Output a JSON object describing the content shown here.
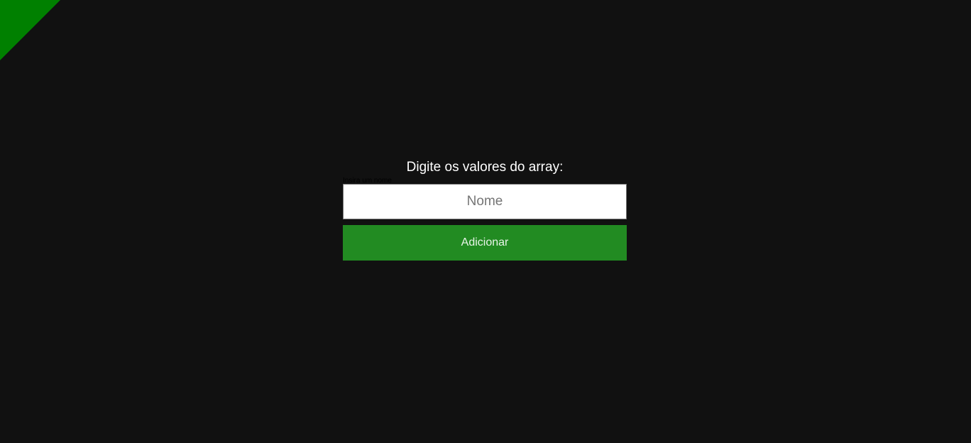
{
  "form": {
    "title": "Digite os valores do array:",
    "hint": "Insira um nome",
    "input_placeholder": "Nome",
    "input_value": "",
    "button_label": "Adicionar"
  },
  "colors": {
    "background": "#111111",
    "accent": "#008000",
    "button": "#228b22"
  }
}
